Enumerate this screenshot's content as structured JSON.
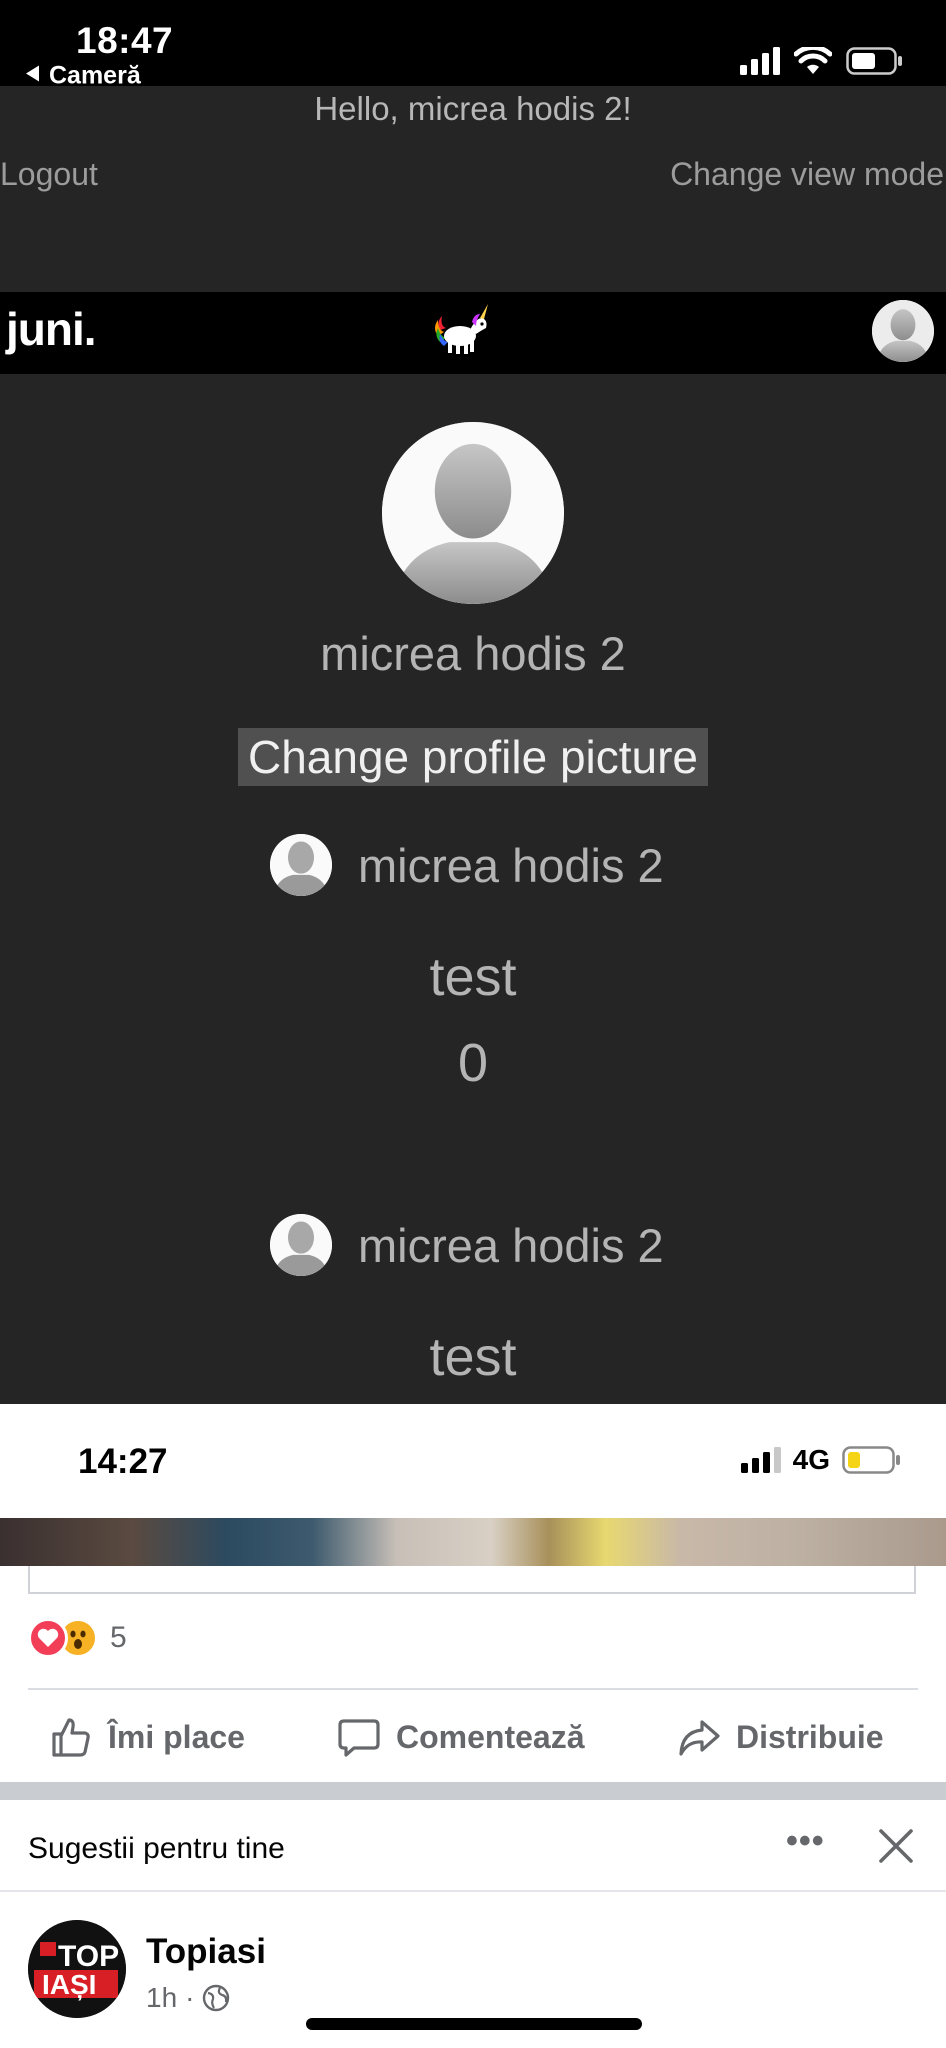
{
  "status_top": {
    "time": "18:47",
    "back_label": "Cameră"
  },
  "header": {
    "greeting": "Hello, micrea hodis 2!",
    "logout": "Logout",
    "view_mode": "Change view mode"
  },
  "navbar": {
    "brand": "juni."
  },
  "profile": {
    "name": "micrea hodis 2",
    "change_picture": "Change profile picture"
  },
  "posts": [
    {
      "author": "micrea hodis 2",
      "text": "test",
      "count": "0"
    },
    {
      "author": "micrea hodis 2",
      "text": "test"
    }
  ],
  "status_bottom": {
    "time": "14:27",
    "network": "4G"
  },
  "fb_post": {
    "reaction_count": "5",
    "actions": {
      "like": "Îmi place",
      "comment": "Comentează",
      "share": "Distribuie"
    }
  },
  "suggestions": {
    "title": "Sugestii pentru tine",
    "page_name": "Topiasi",
    "page_time": "1h",
    "page_logo_line1": "TOP",
    "page_logo_line2": "IAȘI"
  },
  "colors": {
    "dark_bg": "#252525",
    "fb_gray": "#65676b",
    "love": "#f33e58",
    "wow": "#f7b125"
  }
}
